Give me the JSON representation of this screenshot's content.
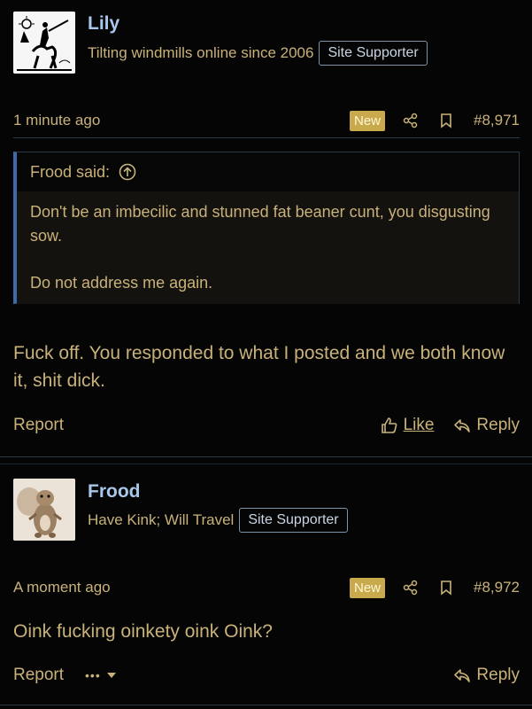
{
  "posts": [
    {
      "username": "Lily",
      "user_title": "Tilting windmills online since 2006",
      "badge": "Site Supporter",
      "time": "1 minute ago",
      "new_label": "New",
      "post_number": "#8,971",
      "avatar_icon": "don-quixote-avatar",
      "quote": {
        "author_line": "Frood said:",
        "lines": [
          "Don't be an imbecilic and stunned fat beaner cunt, you disgusting sow.",
          "Do not address me again."
        ]
      },
      "message": "Fuck off. You responded to what I posted and we both know it, shit dick.",
      "report_label": "Report",
      "like_label": "Like",
      "reply_label": "Reply"
    },
    {
      "username": "Frood",
      "user_title": "Have Kink; Will Travel",
      "badge": "Site Supporter",
      "time": "A moment ago",
      "new_label": "New",
      "post_number": "#8,972",
      "avatar_icon": "squirrel-avatar",
      "message": "Oink fucking oinkety oink Oink?",
      "report_label": "Report",
      "more_label": "•••",
      "reply_label": "Reply"
    }
  ],
  "colors": {
    "background": "#050505",
    "text": "#c9b27a",
    "username": "#a9c7ea",
    "accent_border": "#3f6aa8",
    "new_badge": "#c8a94c"
  }
}
